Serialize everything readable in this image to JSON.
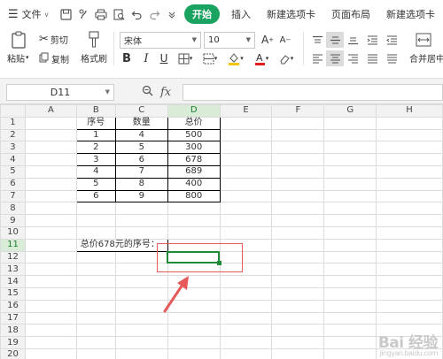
{
  "menubar": {
    "file_label": "文件",
    "tabs": [
      "开始",
      "插入",
      "新建选项卡",
      "页面布局",
      "新建选项卡"
    ],
    "active_tab": "开始"
  },
  "ribbon": {
    "paste_label": "粘贴",
    "cut_label": "剪切",
    "copy_label": "复制",
    "format_painter_label": "格式刷",
    "font_name": "宋体",
    "font_size": "10",
    "merge_label": "合并居中"
  },
  "formula_bar": {
    "cell_ref": "D11",
    "fx_label": "fx",
    "formula": ""
  },
  "sheet": {
    "columns": [
      "A",
      "B",
      "C",
      "D",
      "E",
      "F",
      "G",
      "H"
    ],
    "rows": [
      "1",
      "2",
      "3",
      "4",
      "5",
      "6",
      "7",
      "8",
      "9",
      "10",
      "11",
      "12",
      "13",
      "14",
      "15",
      "16",
      "17",
      "18",
      "19",
      "20"
    ],
    "selected_col": "D",
    "selected_row": "11",
    "headers": [
      "序号",
      "数量",
      "总价"
    ],
    "table_rows": [
      [
        "1",
        "4",
        "500"
      ],
      [
        "2",
        "5",
        "300"
      ],
      [
        "3",
        "6",
        "678"
      ],
      [
        "4",
        "7",
        "689"
      ],
      [
        "5",
        "8",
        "400"
      ],
      [
        "6",
        "9",
        "800"
      ]
    ],
    "label_b11": "总价678元的序号："
  },
  "watermark": {
    "text": "Bai 经验",
    "sub": "jingyan.baidu.com"
  },
  "colors": {
    "active_tab": "#1aa260",
    "selection": "#1f8a3a",
    "annotation": "#e75a5a"
  }
}
